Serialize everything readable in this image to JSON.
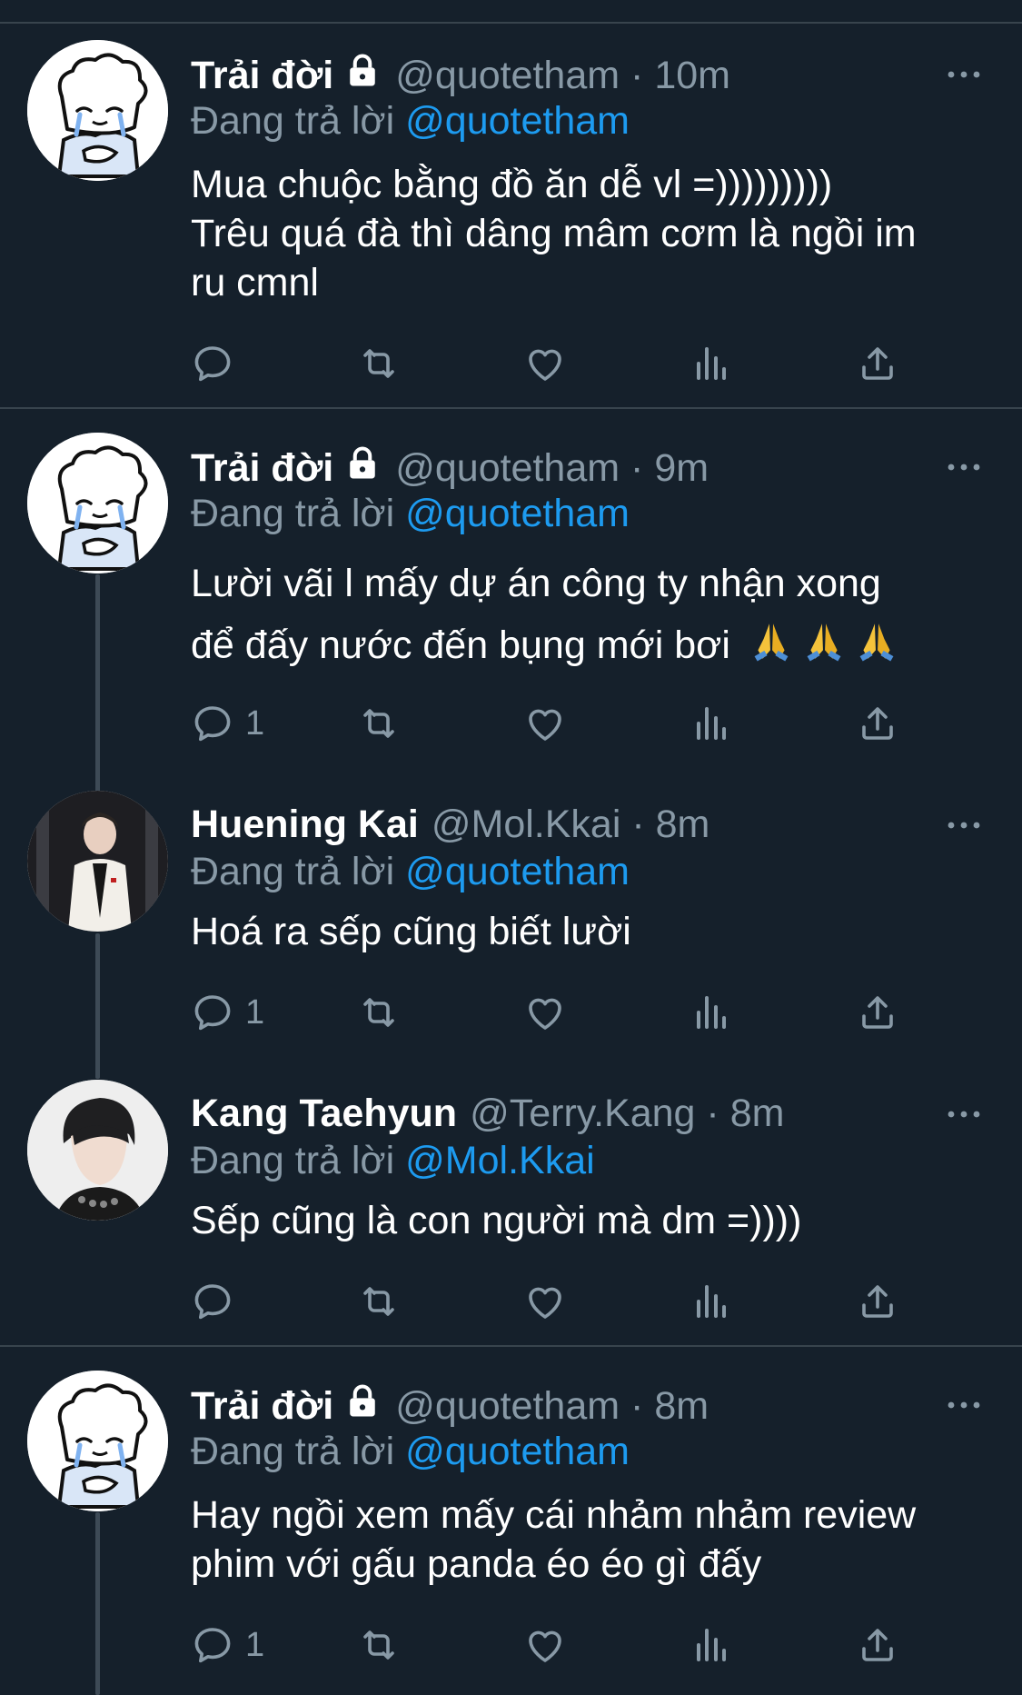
{
  "colors": {
    "background": "#15202b",
    "secondary_text": "#8899a6",
    "mention": "#1d9bf0",
    "divider": "#38444d"
  },
  "tweets": [
    {
      "name": "Trải đời",
      "locked": true,
      "handle": "@quotetham",
      "dot": "·",
      "time": "10m",
      "reply_prefix": "Đang trả lời",
      "reply_to": "@quotetham",
      "text_lines": [
        "Mua chuộc bằng đồ ăn dễ vl =)))))))))",
        "Trêu quá đà thì dâng mâm cơm là ngồi im",
        "ru cmnl"
      ],
      "reply_count": "",
      "avatar_icon": "chef-doodle-avatar"
    },
    {
      "name": "Trải đời",
      "locked": true,
      "handle": "@quotetham",
      "dot": "·",
      "time": "9m",
      "reply_prefix": "Đang trả lời",
      "reply_to": "@quotetham",
      "text_lines": [
        "Lười vãi l mấy dự án công ty nhận xong",
        "để đấy nước đến bụng mới bơi"
      ],
      "emoji": "folded-hands-emoji ×3",
      "reply_count": "1",
      "avatar_icon": "chef-doodle-avatar"
    },
    {
      "name": "Huening Kai",
      "locked": false,
      "handle": "@Mol.Kkai",
      "dot": "·",
      "time": "8m",
      "reply_prefix": "Đang trả lời",
      "reply_to": "@quotetham",
      "text_lines": [
        "Hoá ra sếp cũng biết lười"
      ],
      "reply_count": "1",
      "avatar_icon": "person-photo-avatar"
    },
    {
      "name": "Kang Taehyun",
      "locked": false,
      "handle": "@Terry.Kang",
      "dot": "·",
      "time": "8m",
      "reply_prefix": "Đang trả lời",
      "reply_to": "@Mol.Kkai",
      "text_lines": [
        "Sếp cũng là con người mà dm =))))"
      ],
      "reply_count": "",
      "avatar_icon": "person-photo-avatar"
    },
    {
      "name": "Trải đời",
      "locked": true,
      "handle": "@quotetham",
      "dot": "·",
      "time": "8m",
      "reply_prefix": "Đang trả lời",
      "reply_to": "@quotetham",
      "text_lines": [
        "Hay ngồi xem mấy cái nhảm nhảm review",
        "phim với gấu panda éo éo gì đấy"
      ],
      "reply_count": "1",
      "avatar_icon": "chef-doodle-avatar"
    }
  ],
  "action_icons": [
    "reply-icon",
    "retweet-icon",
    "like-icon",
    "analytics-icon",
    "share-icon"
  ]
}
